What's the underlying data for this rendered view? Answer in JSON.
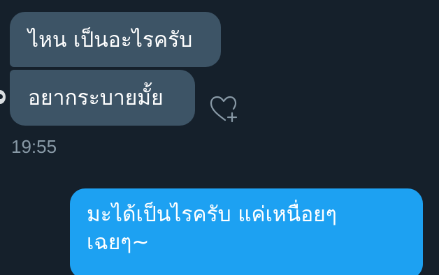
{
  "messages": {
    "incoming": [
      {
        "text": "ไหน เป็นอะไรครับ"
      },
      {
        "text": "อยากระบายมั้ย"
      }
    ],
    "timestamp": "19:55",
    "outgoing": {
      "line1": "มะได้เป็นไรครับ แค่เหนื่อยๆ",
      "line2": "เฉยๆ~"
    }
  },
  "icons": {
    "like": "heart-plus-icon",
    "avatar": "avatar"
  },
  "colors": {
    "background": "#15202b",
    "incoming_bubble": "#3d5466",
    "outgoing_bubble": "#1da1f2",
    "timestamp": "#8899a6",
    "text": "#ffffff"
  }
}
